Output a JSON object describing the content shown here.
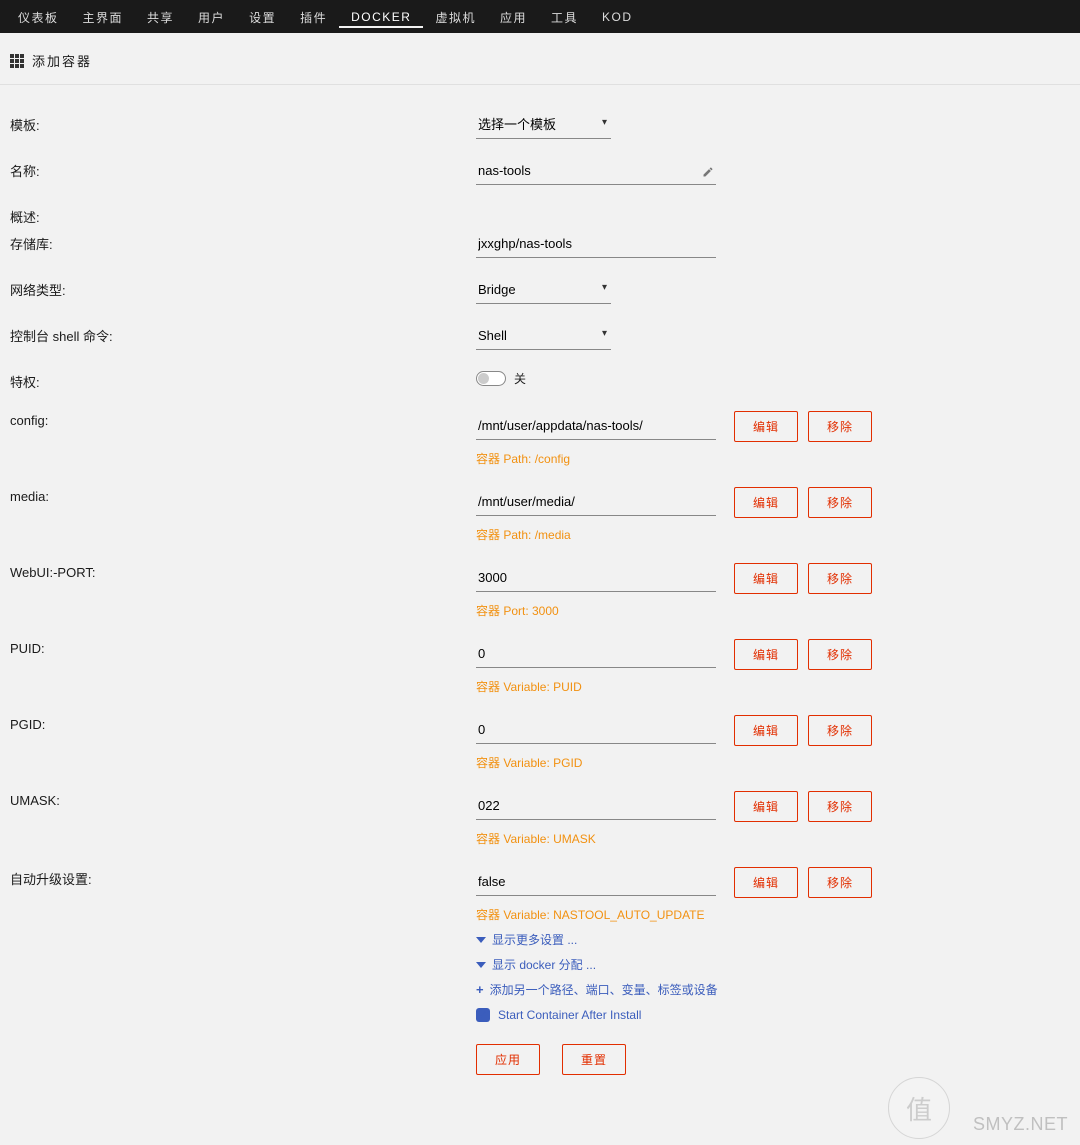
{
  "nav": [
    "仪表板",
    "主界面",
    "共享",
    "用户",
    "设置",
    "插件",
    "DOCKER",
    "虚拟机",
    "应用",
    "工具",
    "KOD"
  ],
  "nav_active_index": 6,
  "page_title": "添加容器",
  "labels": {
    "template": "模板:",
    "name": "名称:",
    "overview": "概述:",
    "repository": "存储库:",
    "network": "网络类型:",
    "console": "控制台 shell 命令:",
    "privileged": "特权:",
    "config": "config:",
    "media": "media:",
    "webui": "WebUI:-PORT:",
    "puid": "PUID:",
    "pgid": "PGID:",
    "umask": "UMASK:",
    "auto_upgrade": "自动升级设置:"
  },
  "template_select": "选择一个模板",
  "name_value": "nas-tools",
  "repository_value": "jxxghp/nas-tools",
  "network_value": "Bridge",
  "console_value": "Shell",
  "privileged_off": "关",
  "buttons": {
    "edit": "编辑",
    "remove": "移除",
    "apply": "应用",
    "reset": "重置"
  },
  "rows": {
    "config": {
      "value": "/mnt/user/appdata/nas-tools/",
      "sub": "容器 Path: /config"
    },
    "media": {
      "value": "/mnt/user/media/",
      "sub": "容器 Path: /media"
    },
    "webui": {
      "value": "3000",
      "sub": "容器 Port: 3000"
    },
    "puid": {
      "value": "0",
      "sub": "容器 Variable: PUID"
    },
    "pgid": {
      "value": "0",
      "sub": "容器 Variable: PGID"
    },
    "umask": {
      "value": "022",
      "sub": "容器 Variable: UMASK"
    },
    "auto": {
      "value": "false",
      "sub": "容器 Variable: NASTOOL_AUTO_UPDATE"
    }
  },
  "links": {
    "more": "显示更多设置 ...",
    "alloc": "显示 docker 分配 ...",
    "add": "添加另一个路径、端口、变量、标签或设备"
  },
  "checkbox_label": "Start Container After Install",
  "watermark": "SMYZ.NET",
  "stamp": "值"
}
